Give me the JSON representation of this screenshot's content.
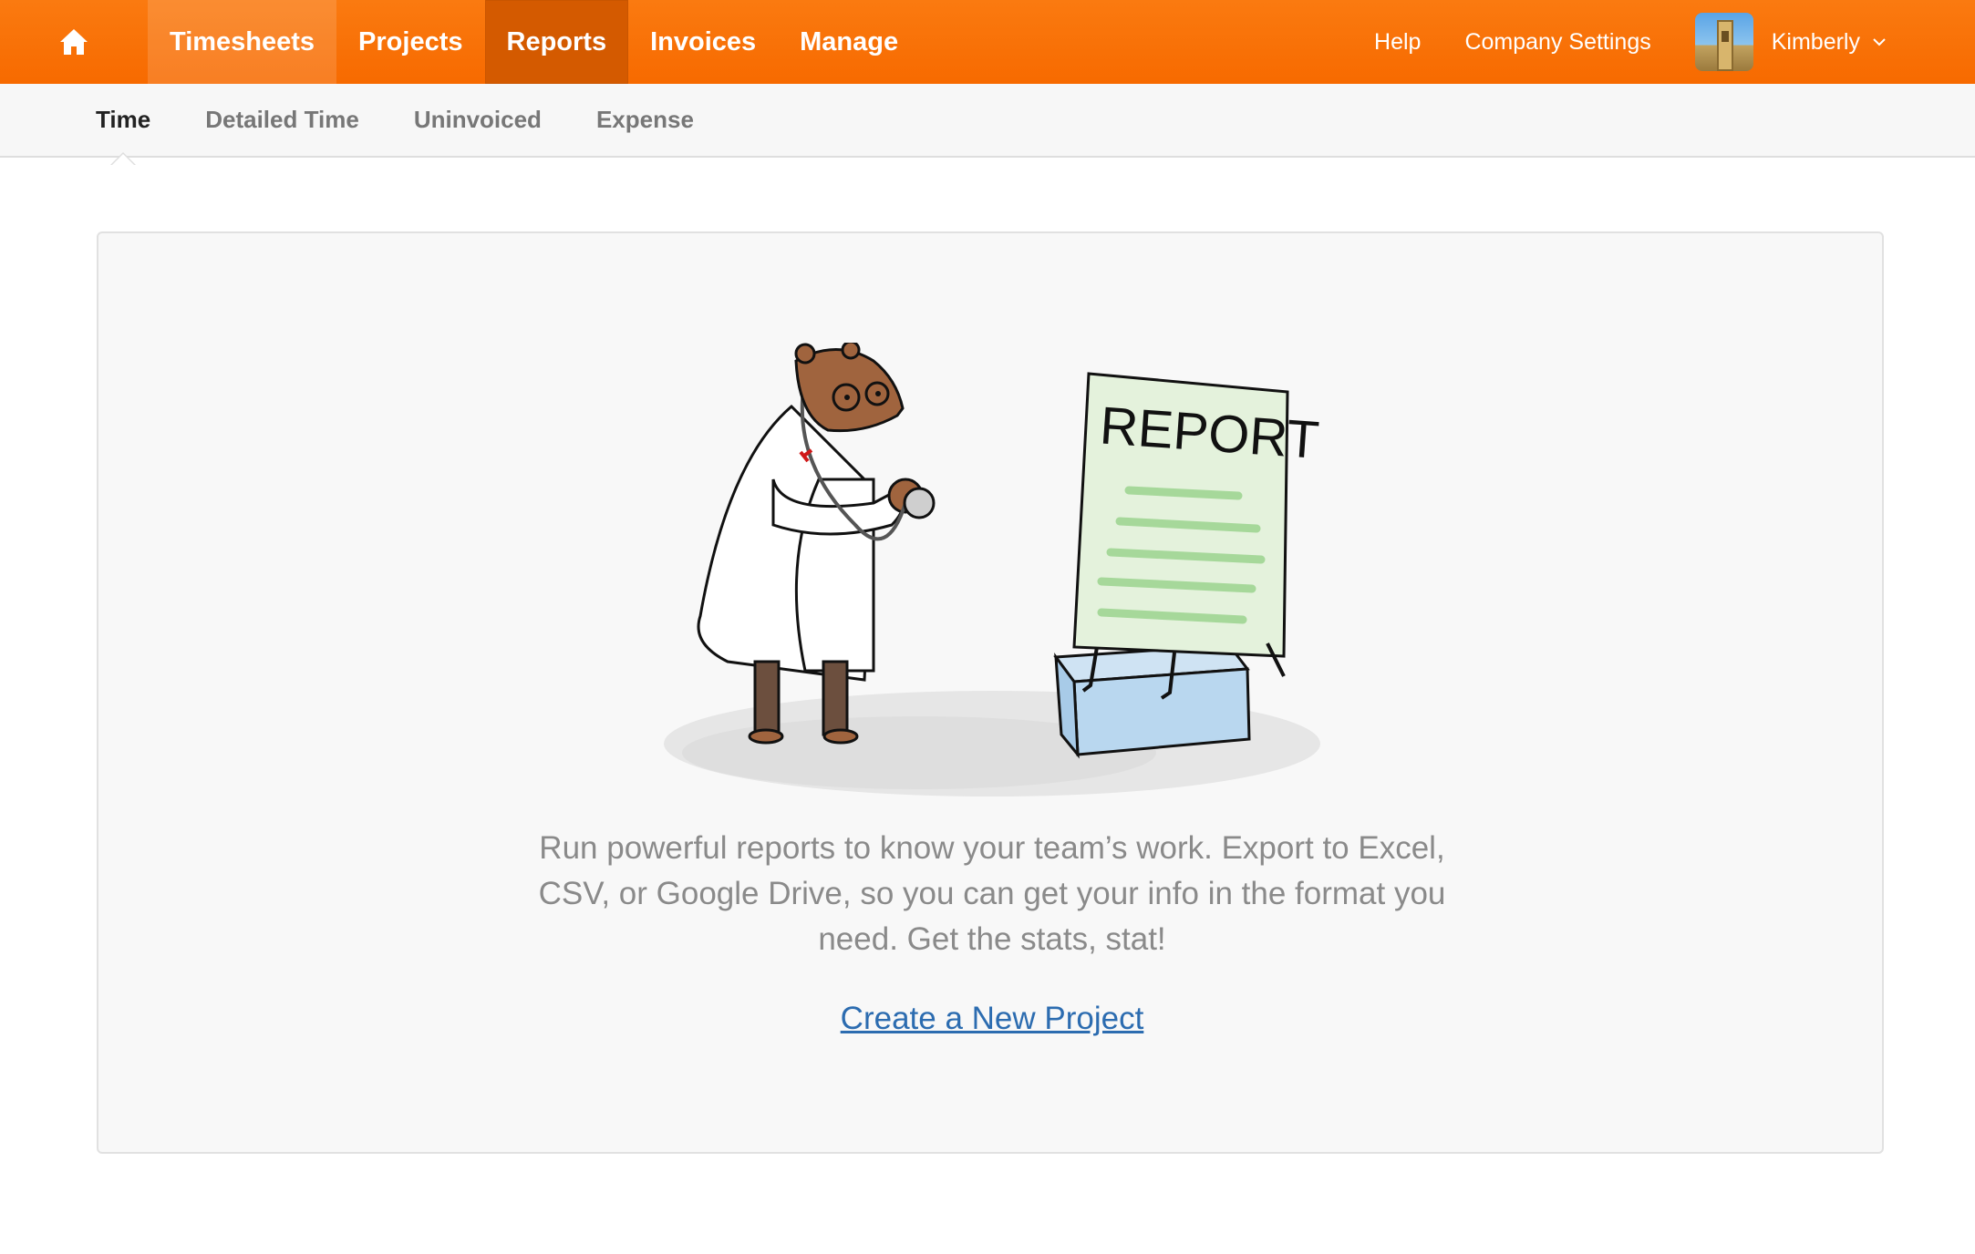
{
  "topnav": {
    "home_icon": "home-icon",
    "items": [
      {
        "label": "Timesheets"
      },
      {
        "label": "Projects"
      },
      {
        "label": "Reports"
      },
      {
        "label": "Invoices"
      },
      {
        "label": "Manage"
      }
    ],
    "active": "Reports",
    "help": "Help",
    "company_settings": "Company Settings",
    "user_name": "Kimberly",
    "accent_color": "#f76a00"
  },
  "subnav": {
    "items": [
      {
        "label": "Time"
      },
      {
        "label": "Detailed Time"
      },
      {
        "label": "Uninvoiced"
      },
      {
        "label": "Expense"
      }
    ],
    "active": "Time"
  },
  "empty_state": {
    "illustration_text": "REPORT",
    "message": "Run powerful reports to know your team’s work. Export to Excel, CSV, or Google Drive, so you can get your info in the format you need. Get the stats, stat!",
    "link": "Create a New Project",
    "link_color": "#2c6cb0"
  }
}
